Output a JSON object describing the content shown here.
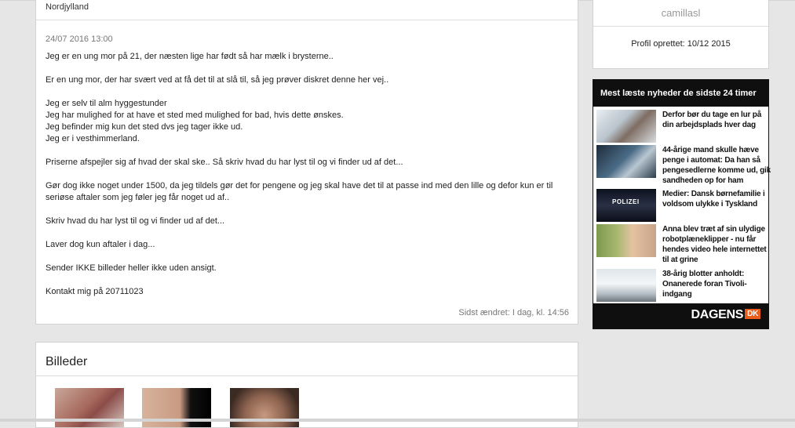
{
  "post": {
    "region": "Nordjylland",
    "date": "24/07 2016 13:00",
    "paragraphs": [
      "Jeg er en ung mor på 21, der næsten lige har født så har mælk i brysterne..",
      "Er en ung mor, der har svært ved at få det til at slå til, så jeg prøver diskret denne her vej..",
      "Jeg er selv til alm hyggestunder\nJeg har mulighed for at have et sted med mulighed for bad, hvis dette ønskes.\nJeg befinder mig kun det sted dvs jeg tager ikke ud.\nJeg er i vesthimmerland.",
      "Priserne afspejler sig af hvad der skal ske.. Så skriv hvad du har lyst til og vi finder ud af det...",
      "Gør dog ikke noget under 1500, da jeg tildels gør det for pengene og jeg skal have det til at passe ind med den lille og defor kun er til seriøse aftaler som jeg føler jeg får noget ud af..",
      "Skriv hvad du har lyst til og vi finder ud af det...",
      "Laver dog kun aftaler i dag...",
      "Sender IKKE billeder heller ikke uden ansigt.",
      "Kontakt mig på 20711023"
    ],
    "last_edited": "Sidst ændret: I dag, kl. 14:56"
  },
  "images": {
    "title": "Billeder"
  },
  "profile": {
    "username": "camillasl",
    "created": "Profil oprettet: 10/12 2015"
  },
  "news": {
    "header": "Mest læste nyheder de sidste 24 timer",
    "items": [
      {
        "text": "Derfor bør du tage en lur på din arbejdsplads hver dag"
      },
      {
        "text": "44-årige mand skulle hæve penge i automat: Da han så pengesedlerne komme ud, gik sandheden op for ham"
      },
      {
        "text": "Medier: Dansk børnefamilie i voldsom ulykke i Tyskland",
        "image_caption": "POLIZEI"
      },
      {
        "text": "Anna blev træt af sin ulydige robotplæneklipper - nu får hendes video hele internettet til at grine"
      },
      {
        "text": "38-årig blotter anholdt: Onanerede foran Tivoli-indgang"
      }
    ],
    "logo": "DAGENS",
    "logo_badge": "DK"
  }
}
